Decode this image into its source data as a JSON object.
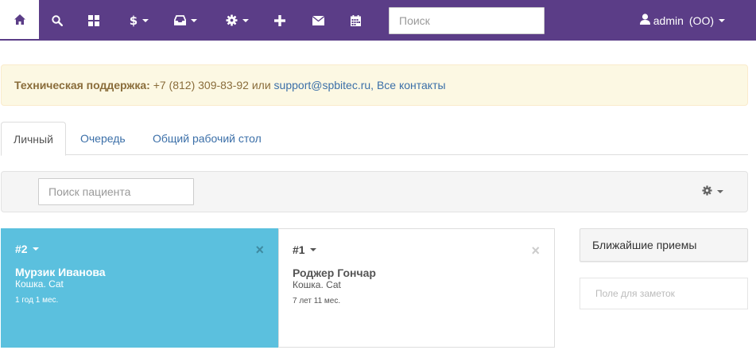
{
  "navbar": {
    "items": [
      {
        "icon": "home-icon",
        "active": true
      },
      {
        "icon": "search-icon"
      },
      {
        "icon": "dashboard-grid-icon"
      },
      {
        "icon": "dollar-icon",
        "dropdown": true
      },
      {
        "icon": "inbox-icon",
        "dropdown": true
      },
      {
        "icon": "gear-icon",
        "dropdown": true
      },
      {
        "icon": "plus-icon"
      },
      {
        "icon": "envelope-icon"
      },
      {
        "icon": "calendar-icon"
      }
    ],
    "search_placeholder": "Поиск",
    "user": {
      "icon": "user-icon",
      "name": "admin",
      "org": "(ОО)"
    },
    "colors": {
      "background": "#5b3d87",
      "active_tab": "#ffffff"
    }
  },
  "support": {
    "label": "Техническая поддержка:",
    "phone": " +7 (812) 309-83-92 или ",
    "email": "support@spbitec.ru",
    "separator": ", ",
    "contacts_link": "Все контакты",
    "colors": {
      "background": "#fcf8e3",
      "text": "#8a6d3b",
      "link": "#3b6fa8"
    }
  },
  "tabs": [
    {
      "label": "Личный",
      "active": true
    },
    {
      "label": "Очередь"
    },
    {
      "label": "Общий рабочий стол"
    }
  ],
  "toolbar": {
    "patient_search_placeholder": "Поиск пациента",
    "settings_icon": "gear-icon"
  },
  "queue_cards": [
    {
      "number": "#2",
      "name": "Мурзик Иванова",
      "species": "Кошка. Cat",
      "age": "1 год 1 мес.",
      "highlighted": true,
      "color": "#5bc0de"
    },
    {
      "number": "#1",
      "name": "Роджер Гончар",
      "species": "Кошка. Cat",
      "age": "7 лет 11 мес.",
      "highlighted": false
    }
  ],
  "sidebar": {
    "upcoming_label": "Ближайшие приемы",
    "notes_placeholder": "Поле для заметок"
  }
}
